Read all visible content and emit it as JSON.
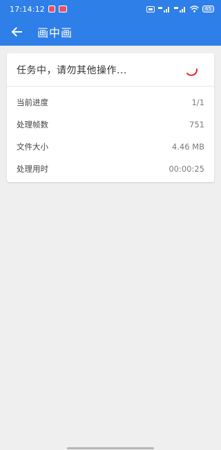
{
  "status_bar": {
    "time": "17:14:12",
    "battery_level": "65",
    "icons": [
      "notification-icon",
      "app-notification-icon",
      "hd-icon",
      "4g-signal-icon",
      "4g-signal-icon",
      "wifi-icon",
      "battery-icon"
    ]
  },
  "app_bar": {
    "title": "画中画",
    "back_icon": "arrow-left-icon"
  },
  "task_card": {
    "message": "任务中，请勿其他操作...",
    "spinner_color": "#e8202a",
    "rows": [
      {
        "label": "当前进度",
        "value": "1/1"
      },
      {
        "label": "处理帧数",
        "value": "751"
      },
      {
        "label": "文件大小",
        "value": "4.46 MB"
      },
      {
        "label": "处理用时",
        "value": "00:00:25"
      }
    ]
  },
  "colors": {
    "primary": "#2f7fe8",
    "background": "#efefef",
    "card": "#ffffff"
  }
}
